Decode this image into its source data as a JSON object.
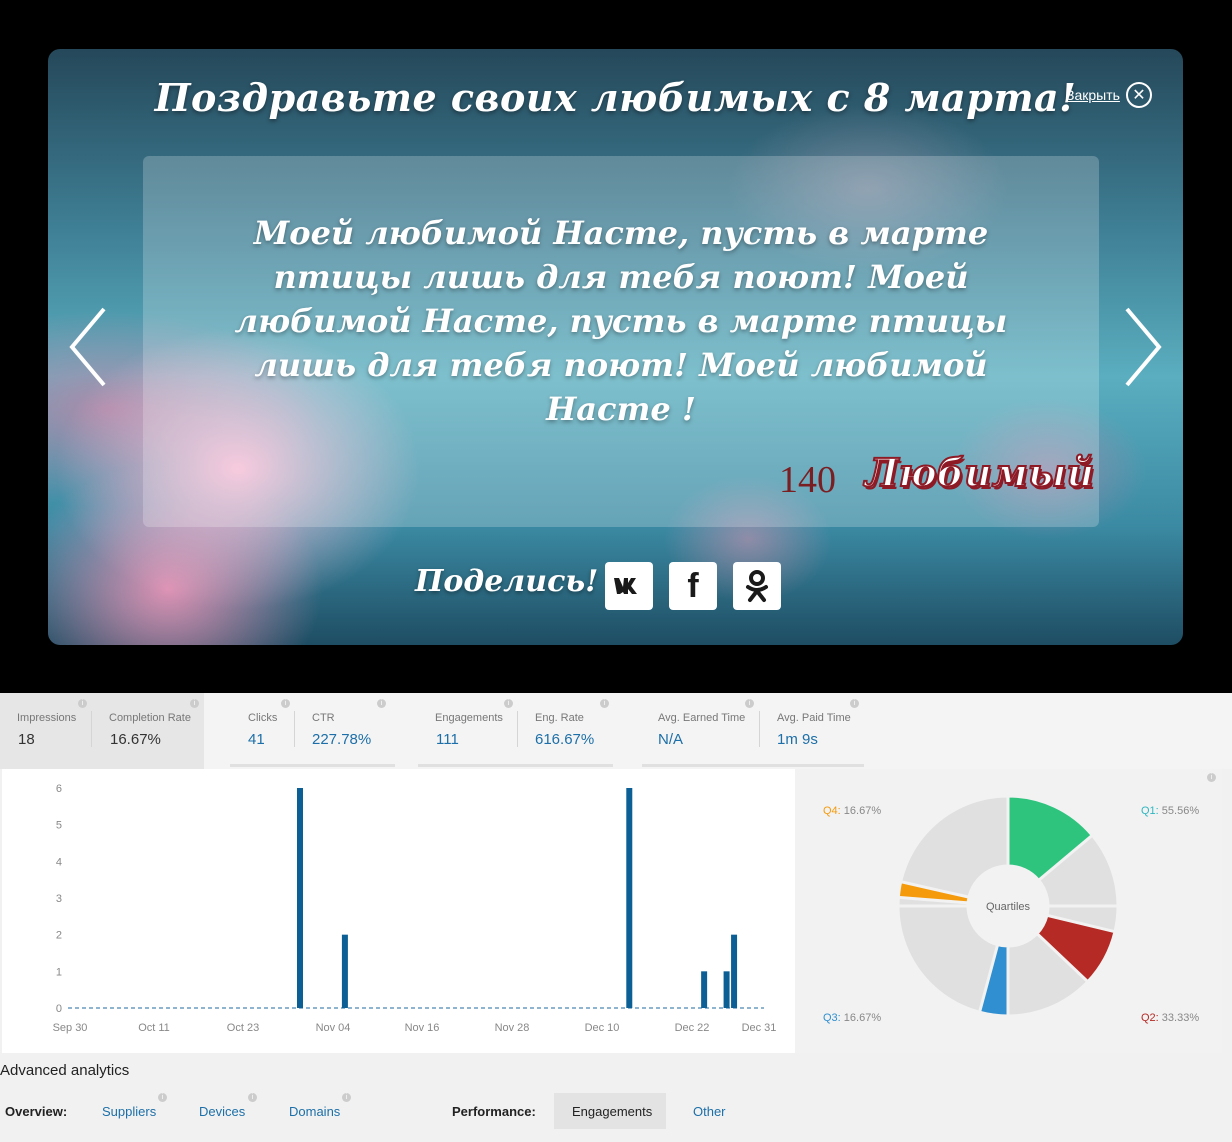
{
  "banner": {
    "title": "Поздравьте своих любимых с 8 марта!",
    "close_label": "Закрыть",
    "message": "Моей любимой Насте, пусть в марте птицы лишь для тебя поют! Моей любимой Насте, пусть в марте птицы лишь для тебя поют! Моей любимой Насте !",
    "counter": "140",
    "signature": "Любимый",
    "share_label": "Поделись!",
    "share_buttons": [
      "vk",
      "facebook",
      "odnoklassniki"
    ]
  },
  "stats": {
    "impressions": {
      "label": "Impressions",
      "value": "18"
    },
    "completion_rate": {
      "label": "Completion Rate",
      "value": "16.67%"
    },
    "clicks": {
      "label": "Clicks",
      "value": "41"
    },
    "ctr": {
      "label": "CTR",
      "value": "227.78%"
    },
    "engagements": {
      "label": "Engagements",
      "value": "111"
    },
    "eng_rate": {
      "label": "Eng. Rate",
      "value": "616.67%"
    },
    "avg_earned_time": {
      "label": "Avg. Earned Time",
      "value": "N/A"
    },
    "avg_paid_time": {
      "label": "Avg. Paid Time",
      "value": "1m 9s"
    }
  },
  "chart_data": [
    {
      "type": "bar",
      "x_ticks": [
        "Sep 30",
        "Oct 11",
        "Oct 23",
        "Nov 04",
        "Nov 16",
        "Nov 28",
        "Dec 10",
        "Dec 22",
        "Dec 31"
      ],
      "y_ticks": [
        0,
        1,
        2,
        3,
        4,
        5,
        6
      ],
      "ylim": [
        0,
        6
      ],
      "xlim": [
        "2014-09-30",
        "2015-01-01"
      ],
      "bars": [
        {
          "date": "2014-10-31",
          "value": 6
        },
        {
          "date": "2014-11-06",
          "value": 2
        },
        {
          "date": "2014-12-14",
          "value": 6
        },
        {
          "date": "2014-12-24",
          "value": 1
        },
        {
          "date": "2014-12-27",
          "value": 1
        },
        {
          "date": "2014-12-28",
          "value": 2
        }
      ],
      "color": "#0b5f94"
    },
    {
      "type": "pie",
      "center_label": "Quartiles",
      "slices": [
        {
          "name": "Q1",
          "value": 55.56,
          "color": "#2ec47e"
        },
        {
          "name": "Q2",
          "value": 33.33,
          "color": "#b52a24"
        },
        {
          "name": "Q3",
          "value": 16.67,
          "color": "#2f8fd0"
        },
        {
          "name": "Q4",
          "value": 16.67,
          "color": "#f59a0b"
        }
      ],
      "labels": {
        "q1": {
          "name": "Q1:",
          "value": "55.56%",
          "color": "#2fb6c0"
        },
        "q2": {
          "name": "Q2:",
          "value": "33.33%",
          "color": "#b52a24"
        },
        "q3": {
          "name": "Q3:",
          "value": "16.67%",
          "color": "#2f8fd0"
        },
        "q4": {
          "name": "Q4:",
          "value": "16.67%",
          "color": "#f59a0b"
        }
      }
    }
  ],
  "advanced": {
    "title": "Advanced analytics",
    "overview_label": "Overview:",
    "overview_tabs": [
      "Suppliers",
      "Devices",
      "Domains"
    ],
    "performance_label": "Performance:",
    "performance_tabs": [
      "Engagements",
      "Other"
    ]
  }
}
